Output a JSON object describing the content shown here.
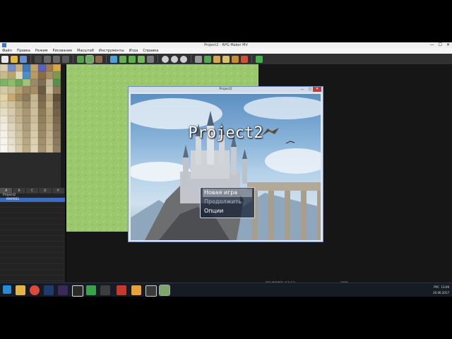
{
  "window": {
    "title": "Project2 - RPG Maker MV",
    "min": "—",
    "max": "☐",
    "close": "✕"
  },
  "menubar": [
    "Файл",
    "Правка",
    "Режим",
    "Рисование",
    "Масштаб",
    "Инструменты",
    "Игра",
    "Справка"
  ],
  "maplist": {
    "tabs": [
      "A",
      "B",
      "C",
      "D",
      "R"
    ],
    "project": "Project2",
    "selected_map": "MAP001"
  },
  "game_window": {
    "title": "Project2",
    "close": "✕",
    "game_title": "Project2",
    "menu": [
      {
        "label": "Новая игра",
        "state": "selected"
      },
      {
        "label": "Продолжить",
        "state": "disabled"
      },
      {
        "label": "Опции",
        "state": "normal"
      }
    ]
  },
  "statusbar": {
    "map": "001:MAP001 (17x13)",
    "zoom": "100%"
  },
  "taskbar": {
    "lang": "РУС",
    "time": "13:09",
    "date": "20.06.2017"
  },
  "colors": {
    "grass": "#9bc86d",
    "selection": "#3f6cc2",
    "close_button": "#c9382c"
  }
}
